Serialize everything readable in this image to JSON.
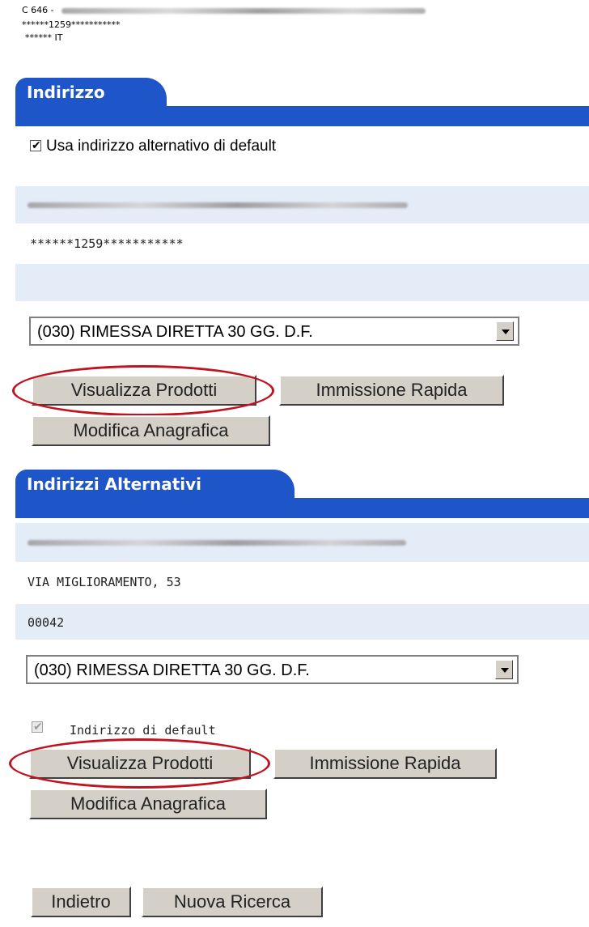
{
  "customer": {
    "code_prefix": "C 646 -",
    "masked_id": "******1259***********",
    "country": "****** IT"
  },
  "section_address": {
    "title": "Indirizzo",
    "checkbox_label": "Usa indirizzo alternativo di default",
    "checkbox_checked": true,
    "masked_line": "******1259***********",
    "payment_select": "(030) RIMESSA DIRETTA 30 GG. D.F.",
    "buttons": {
      "view_products": "Visualizza Prodotti",
      "quick_entry": "Immissione Rapida",
      "edit_registry": "Modifica Anagrafica"
    }
  },
  "section_alt": {
    "title": "Indirizzi Alternativi",
    "street": "VIA MIGLIORAMENTO, 53",
    "zip": "00042",
    "payment_select": "(030) RIMESSA DIRETTA 30 GG. D.F.",
    "default_label": "Indirizzo di default",
    "default_checked": true,
    "buttons": {
      "view_products": "Visualizza Prodotti",
      "quick_entry": "Immissione Rapida",
      "edit_registry": "Modifica Anagrafica"
    }
  },
  "footer": {
    "back": "Indietro",
    "new_search": "Nuova Ricerca"
  },
  "annotation_color": "#c1121f",
  "tab_color": "#1e55c8",
  "band_color": "#e3ecf7"
}
